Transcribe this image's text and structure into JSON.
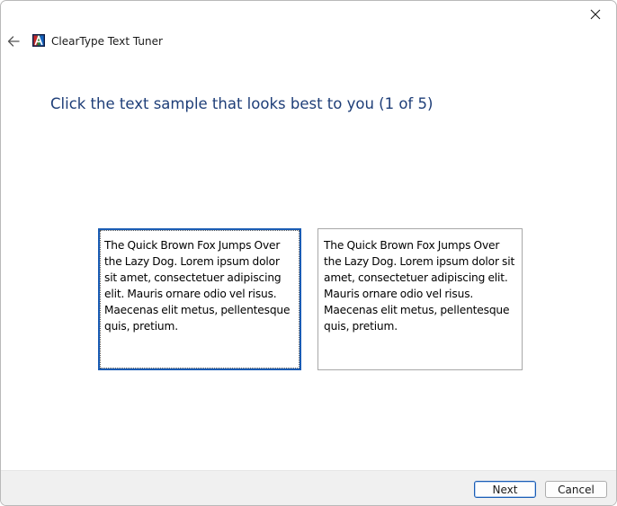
{
  "window": {
    "title": "ClearType Text Tuner"
  },
  "instruction": "Click the text sample that looks best to you (1 of 5)",
  "samples": [
    {
      "text": "The Quick Brown Fox Jumps Over the Lazy Dog. Lorem ipsum dolor sit amet, consectetuer adipiscing elit. Mauris ornare odio vel risus. Maecenas elit metus, pellentesque quis, pretium.",
      "selected": true
    },
    {
      "text": "The Quick Brown Fox Jumps Over the Lazy Dog. Lorem ipsum dolor sit amet, consectetuer adipiscing elit. Mauris ornare odio vel risus. Maecenas elit metus, pellentesque quis, pretium.",
      "selected": false
    }
  ],
  "buttons": {
    "next_label": "Next",
    "cancel_label": "Cancel"
  },
  "icons": {
    "back": "back-arrow-icon",
    "close": "close-icon",
    "app": "cleartype-app-icon"
  },
  "colors": {
    "instruction": "#1e3e78",
    "selection_border": "#1a5cb4",
    "footer_bg": "#f0f0f0"
  }
}
